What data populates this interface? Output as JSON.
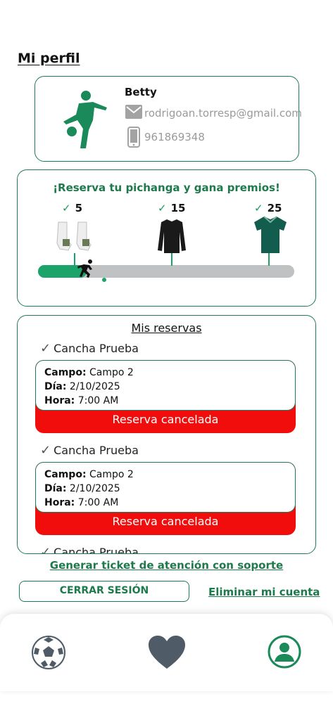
{
  "header": {
    "title": "Mi perfil"
  },
  "profile": {
    "name": "Betty",
    "email": "rodrigoan.torresp@gmail.com",
    "phone": "961869348"
  },
  "rewards": {
    "title": "¡Reserva tu pichanga y gana premios!",
    "check": "✓",
    "milestones": [
      {
        "count": "5",
        "prize": "socks"
      },
      {
        "count": "15",
        "prize": "long-sleeve-shirt"
      },
      {
        "count": "25",
        "prize": "jersey"
      }
    ],
    "progress_fraction": 0.19
  },
  "reservations": {
    "title": "Mis reservas",
    "labels": {
      "campo": "Campo:",
      "dia": "Día:",
      "hora": "Hora:"
    },
    "items": [
      {
        "court": "Cancha Prueba",
        "campo": "Campo 2",
        "dia": "2/10/2025",
        "hora": "7:00 AM",
        "status": "Reserva cancelada"
      },
      {
        "court": "Cancha Prueba",
        "campo": "Campo 2",
        "dia": "2/10/2025",
        "hora": "7:00 AM",
        "status": "Reserva cancelada"
      },
      {
        "court": "Cancha Prueba"
      }
    ]
  },
  "actions": {
    "ticket": "Generar ticket de atención con soporte",
    "logout": "CERRAR SESIÓN",
    "delete": "Eliminar mi cuenta"
  },
  "nav": {
    "items": [
      "soccer-ball-icon",
      "heart-icon",
      "profile-icon"
    ]
  },
  "colors": {
    "brand_green": "#1e7a4c",
    "cancel_red": "#f20d0d",
    "track_gray": "#bfc1c3"
  }
}
